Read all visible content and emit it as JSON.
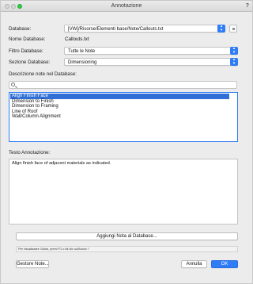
{
  "window": {
    "title": "Annotazione",
    "help": "?"
  },
  "database": {
    "label": "Database:",
    "value": "[VW]/Risorse/Elementi base/Note/Callouts.txt"
  },
  "nome_database": {
    "label": "Nome Database:",
    "value": "Callouts.txt"
  },
  "filtro_database": {
    "label": "Filtro Database:",
    "value": "Tutte le Note"
  },
  "sezione_database": {
    "label": "Sezione Database:",
    "value": "Dimensioning"
  },
  "descrizione": {
    "label": "Descrizione note nel Database:",
    "search_placeholder": "",
    "items": [
      {
        "label": "Align Finish Face",
        "selected": true
      },
      {
        "label": "Dimension to Finish",
        "selected": false
      },
      {
        "label": "Dimension to Framing",
        "selected": false
      },
      {
        "label": "Line of Roof",
        "selected": false
      },
      {
        "label": "Wall/Column Alignment",
        "selected": false
      }
    ]
  },
  "testo": {
    "label": "Testo Annotazione:",
    "value": "Align finish face of adjacent materials as indicated."
  },
  "aggiungi_label": "Aggiungi Nota al Database...",
  "hint": "Per visualizzare l'Aiuto, premi F1 o fai clic sull'icona ?",
  "gestore_label": "Gestore Note...",
  "annulla_label": "Annulla",
  "ok_label": "OK",
  "colors": {
    "accent": "#2f7cf6",
    "selection": "#2f6fd6",
    "max_button": "#2fcf46"
  }
}
